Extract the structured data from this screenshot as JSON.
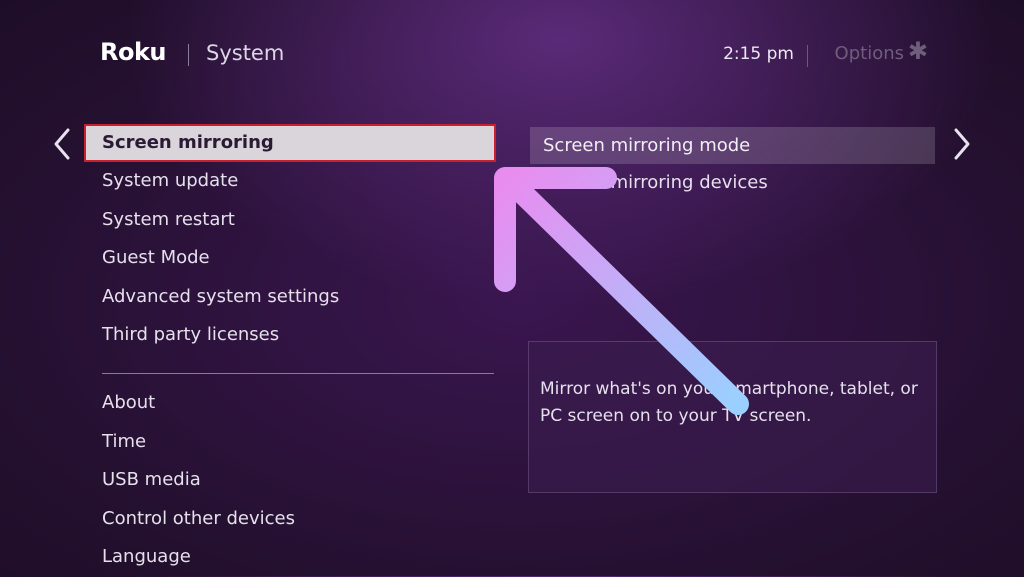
{
  "header": {
    "brand": "Roku",
    "title": "System",
    "time": "2:15  pm",
    "options_label": "Options",
    "options_icon": "asterisk-icon"
  },
  "nav": {
    "left_icon": "chevron-left-icon",
    "right_icon": "chevron-right-icon"
  },
  "menu": {
    "primary": [
      {
        "label": "Screen mirroring",
        "selected": true
      },
      {
        "label": "System update"
      },
      {
        "label": "System restart"
      },
      {
        "label": "Guest Mode"
      },
      {
        "label": "Advanced system settings"
      },
      {
        "label": "Third party licenses"
      }
    ],
    "secondary": [
      {
        "label": "About"
      },
      {
        "label": "Time"
      },
      {
        "label": "USB media"
      },
      {
        "label": "Control other devices"
      },
      {
        "label": "Language"
      }
    ]
  },
  "submenu": {
    "items": [
      {
        "label": "Screen mirroring mode",
        "highlighted": true
      },
      {
        "label": "Screen mirroring devices"
      }
    ]
  },
  "description": "Mirror what's on your smartphone, tablet, or PC screen on to your TV screen.",
  "colors": {
    "selection_outline": "#c8202e",
    "arrow_start": "#e98cf0",
    "arrow_end": "#9ad0ff"
  }
}
